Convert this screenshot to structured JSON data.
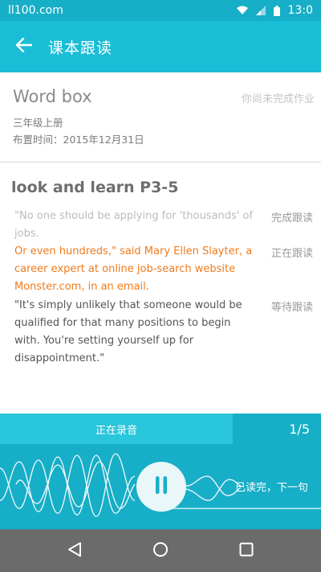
{
  "status_bar": {
    "site": "ll100.com",
    "time": "13:0"
  },
  "app_bar": {
    "title": "课本跟读"
  },
  "info": {
    "title": "Word box",
    "status_note": "你尚未完成作业",
    "grade": "三年级上册",
    "assigned": "布置时间：2015年12月31日"
  },
  "lesson": {
    "title": "look and learn P3-5",
    "sentences": [
      {
        "text": "\"No one should be applying for 'thousands' of jobs.",
        "tag": "完成跟读",
        "state": "done"
      },
      {
        "text": "Or even hundreds,\" said Mary Ellen Slayter, a career expert at online job-search website Monster.com, in an email.",
        "tag": "正在跟读",
        "state": "current"
      },
      {
        "text": "\"It's simply unlikely that someone would be qualified for that many positions to begin with. You're setting yourself up for disappointment.\"",
        "tag": "等待跟读",
        "state": "waiting"
      }
    ]
  },
  "recording": {
    "status": "正在录音",
    "progress": "1/5",
    "next_label": "已读完，下一句"
  },
  "colors": {
    "accent": "#19bdd6",
    "accent_dark": "#17aec7",
    "current": "#f07b1c"
  },
  "icons": [
    "wifi-icon",
    "signal-icon",
    "battery-icon",
    "back-arrow-icon",
    "pause-icon",
    "nav-back-icon",
    "nav-home-icon",
    "nav-recents-icon"
  ]
}
